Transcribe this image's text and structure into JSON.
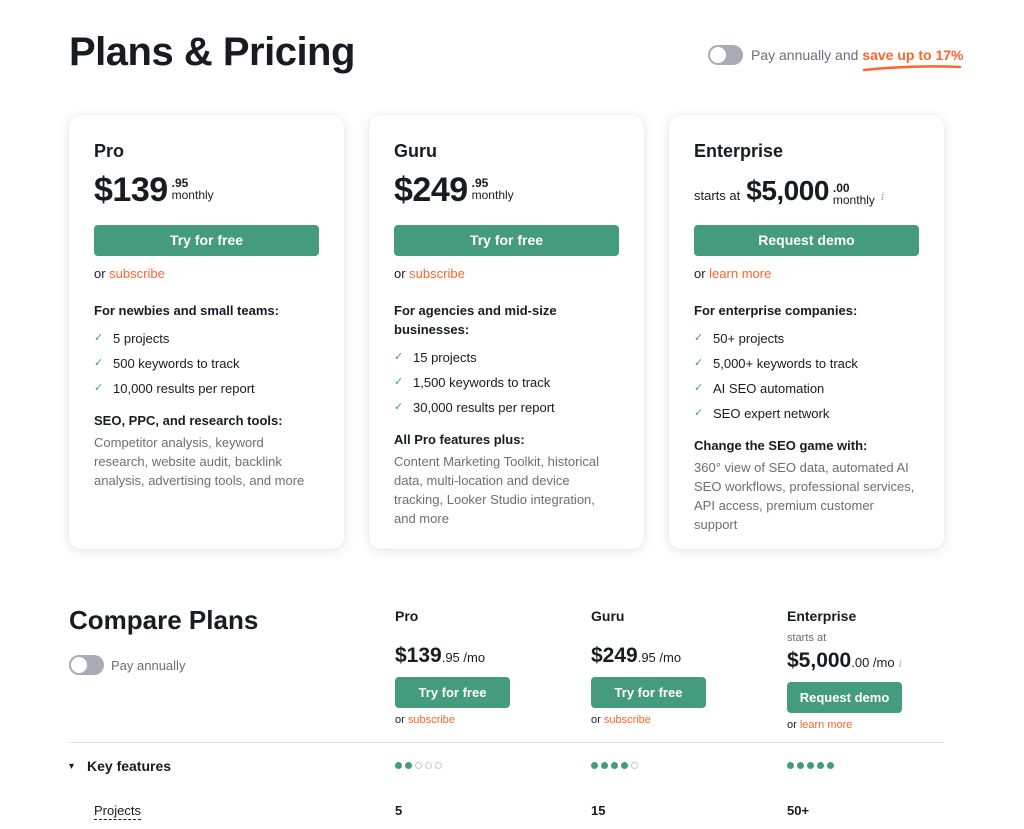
{
  "header": {
    "title": "Plans & Pricing",
    "toggle_label": "Pay annually and ",
    "toggle_highlight": "save up to 17%",
    "toggle_on": false
  },
  "colors": {
    "accent": "#459b7e",
    "link": "#ff642d",
    "text": "#191b23",
    "muted": "#6c6e79"
  },
  "plans": [
    {
      "name": "Pro",
      "prefix": "",
      "price": "$139",
      "cents": ".95",
      "period": "monthly",
      "button": "Try for free",
      "or_text": "or ",
      "or_link": "subscribe",
      "audience": "For newbies and small teams:",
      "features": [
        "5 projects",
        "500 keywords to track",
        "10,000 results per report"
      ],
      "sub_head": "SEO, PPC, and research tools:",
      "sub_body": "Competitor analysis, keyword research, website audit, backlink analysis, advertising tools, and more"
    },
    {
      "name": "Guru",
      "prefix": "",
      "price": "$249",
      "cents": ".95",
      "period": "monthly",
      "button": "Try for free",
      "or_text": "or ",
      "or_link": "subscribe",
      "audience": "For agencies and mid-size businesses:",
      "features": [
        "15 projects",
        "1,500 keywords to track",
        "30,000 results per report"
      ],
      "sub_head": "All Pro features plus:",
      "sub_body": "Content Marketing Toolkit, historical data, multi-location and device tracking, Looker Studio integration, and more"
    },
    {
      "name": "Enterprise",
      "prefix": "starts at",
      "price": "$5,000",
      "cents": ".00",
      "period": "monthly",
      "info": "i",
      "button": "Request demo",
      "or_text": "or ",
      "or_link": "learn more",
      "audience": "For enterprise companies:",
      "features": [
        "50+ projects",
        "5,000+ keywords to track",
        "AI SEO automation",
        "SEO expert network"
      ],
      "sub_head": "Change the SEO game with:",
      "sub_body": "360° view of SEO data, automated AI SEO workflows, professional services, API access, premium customer support"
    }
  ],
  "compare": {
    "title": "Compare Plans",
    "toggle_label": "Pay annually",
    "toggle_on": false,
    "columns": [
      {
        "name": "Pro",
        "starts": "",
        "price": "$139",
        "cents": ".95 /mo",
        "button": "Try for free",
        "or_text": "or ",
        "or_link": "subscribe"
      },
      {
        "name": "Guru",
        "starts": "",
        "price": "$249",
        "cents": ".95 /mo",
        "button": "Try for free",
        "or_text": "or ",
        "or_link": "subscribe"
      },
      {
        "name": "Enterprise",
        "starts": "starts at",
        "price": "$5,000",
        "cents": ".00 /mo",
        "info": "i",
        "button": "Request demo",
        "or_text": "or ",
        "or_link": "learn more"
      }
    ],
    "sections": [
      {
        "title": "Key features",
        "expanded": true,
        "ratings": [
          2,
          4,
          5
        ],
        "rating_max": 5,
        "rows": [
          {
            "label": "Projects",
            "values": [
              "5",
              "15",
              "50+"
            ]
          }
        ]
      }
    ]
  },
  "icons": {
    "check": "✓",
    "chevron": "⌄"
  }
}
